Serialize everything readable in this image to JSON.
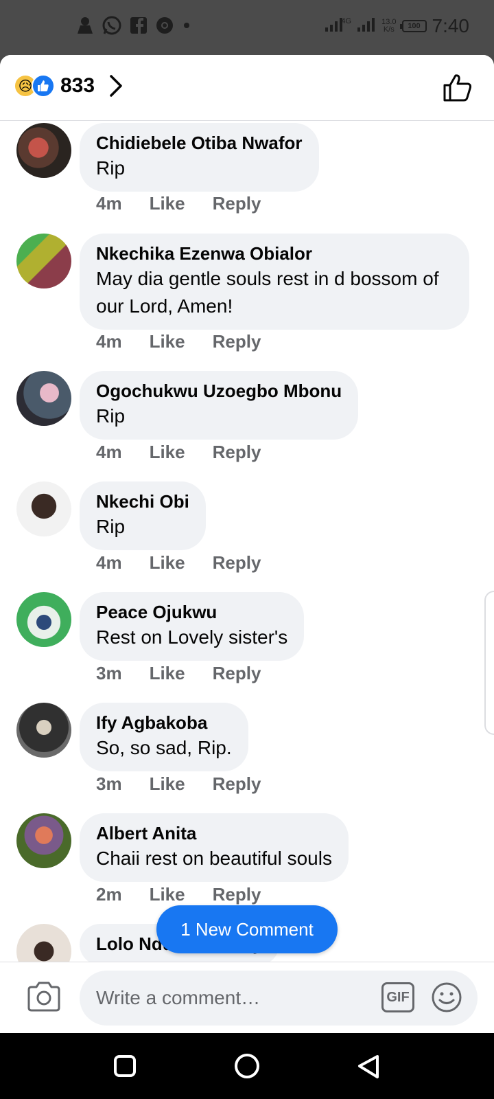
{
  "status_bar": {
    "time": "7:40",
    "network_speed": "13.0",
    "network_unit": "K/s",
    "network_type": "4G",
    "battery": "100",
    "icons": [
      "notification-person-icon",
      "whatsapp-icon",
      "facebook-icon",
      "chrome-icon",
      "dot-icon",
      "signal-icon",
      "signal-icon"
    ]
  },
  "header": {
    "reaction_count": "833",
    "reactions": [
      "sad-reaction",
      "like-reaction"
    ]
  },
  "comments": [
    {
      "author": "Chidiebele Otiba Nwafor",
      "text": "Rip",
      "time": "4m",
      "like": "Like",
      "reply": "Reply"
    },
    {
      "author": "Nkechika Ezenwa Obialor",
      "text": "May dia gentle souls rest in d bossom of our Lord, Amen!",
      "time": "4m",
      "like": "Like",
      "reply": "Reply"
    },
    {
      "author": "Ogochukwu Uzoegbo Mbonu",
      "text": "Rip",
      "time": "4m",
      "like": "Like",
      "reply": "Reply"
    },
    {
      "author": "Nkechi Obi",
      "text": "Rip",
      "time": "4m",
      "like": "Like",
      "reply": "Reply"
    },
    {
      "author": "Peace Ojukwu",
      "text": "Rest on Lovely sister's",
      "time": "3m",
      "like": "Like",
      "reply": "Reply"
    },
    {
      "author": "Ify Agbakoba",
      "text": "So, so sad, Rip.",
      "time": "3m",
      "like": "Like",
      "reply": "Reply"
    },
    {
      "author": "Albert Anita",
      "text": "Chaii rest on beautiful souls",
      "time": "2m",
      "like": "Like",
      "reply": "Reply"
    },
    {
      "author": "Lolo Nduhuisi Nelly",
      "text": "",
      "time": "",
      "like": "",
      "reply": ""
    }
  ],
  "new_comment_button": "1 New Comment",
  "composer": {
    "placeholder": "Write a comment…",
    "gif_label": "GIF"
  },
  "colors": {
    "accent": "#1877f2",
    "bubble": "#f0f2f5",
    "meta_text": "#65676b"
  }
}
